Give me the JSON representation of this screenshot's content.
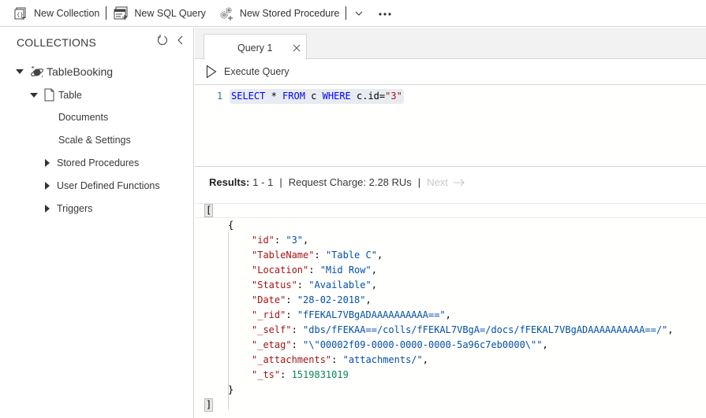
{
  "toolbar": {
    "new_collection": "New Collection",
    "new_sql_query": "New SQL Query",
    "new_stored_procedure": "New Stored Procedure"
  },
  "sidebar": {
    "title": "COLLECTIONS",
    "database": "TableBooking",
    "collection": "Table",
    "items": [
      {
        "label": "Documents"
      },
      {
        "label": "Scale & Settings"
      },
      {
        "label": "Stored Procedures"
      },
      {
        "label": "User Defined Functions"
      },
      {
        "label": "Triggers"
      }
    ]
  },
  "tabs": [
    {
      "label": "Query 1",
      "active": true
    }
  ],
  "commands": {
    "execute_query": "Execute Query"
  },
  "editor": {
    "line_number": "1",
    "tokens": {
      "select": "SELECT",
      "star": " * ",
      "from": "FROM",
      "alias": " c ",
      "where": "WHERE",
      "cond": " c.id=",
      "value": "\"3\""
    }
  },
  "results": {
    "label": "Results:",
    "range": "1 - 1",
    "request_charge": "Request Charge: 2.28 RUs",
    "next": "Next"
  },
  "result_json": {
    "open_bracket": "[",
    "open_brace": "{",
    "close_brace": "}",
    "close_bracket": "]",
    "fields": [
      {
        "key": "\"id\"",
        "value": "\"3\"",
        "type": "string",
        "comma": ","
      },
      {
        "key": "\"TableName\"",
        "value": "\"Table C\"",
        "type": "string",
        "comma": ","
      },
      {
        "key": "\"Location\"",
        "value": "\"Mid Row\"",
        "type": "string",
        "comma": ","
      },
      {
        "key": "\"Status\"",
        "value": "\"Available\"",
        "type": "string",
        "comma": ","
      },
      {
        "key": "\"Date\"",
        "value": "\"28-02-2018\"",
        "type": "string",
        "comma": ","
      },
      {
        "key": "\"_rid\"",
        "value": "\"fFEKAL7VBgADAAAAAAAAAA==\"",
        "type": "string",
        "comma": ","
      },
      {
        "key": "\"_self\"",
        "value": "\"dbs/fFEKAA==/colls/fFEKAL7VBgA=/docs/fFEKAL7VBgADAAAAAAAAAA==/\"",
        "type": "string",
        "comma": ","
      },
      {
        "key": "\"_etag\"",
        "value": "\"\\\"00002f09-0000-0000-0000-5a96c7eb0000\\\"\"",
        "type": "string",
        "comma": ","
      },
      {
        "key": "\"_attachments\"",
        "value": "\"attachments/\"",
        "type": "string",
        "comma": ","
      },
      {
        "key": "\"_ts\"",
        "value": "1519831019",
        "type": "number",
        "comma": ""
      }
    ]
  }
}
